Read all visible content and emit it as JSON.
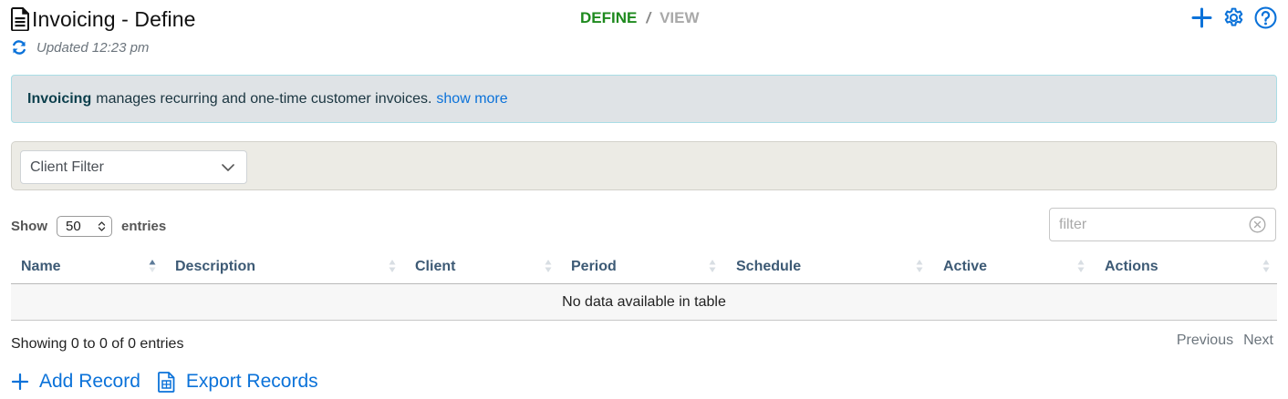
{
  "header": {
    "title": "Invoicing - Define",
    "updated": "Updated 12:23 pm"
  },
  "modes": {
    "define": "DEFINE",
    "separator": "/",
    "view": "VIEW"
  },
  "info": {
    "bold": "Invoicing",
    "text": "manages recurring and one-time customer invoices.",
    "link": "show more"
  },
  "filters": {
    "client_filter": "Client Filter"
  },
  "table_controls": {
    "show_label": "Show",
    "page_size": "50",
    "entries_label": "entries",
    "search_placeholder": "filter"
  },
  "table": {
    "columns": [
      "Name",
      "Description",
      "Client",
      "Period",
      "Schedule",
      "Active",
      "Actions"
    ],
    "empty_message": "No data available in table"
  },
  "footer": {
    "showing": "Showing 0 to 0 of 0 entries",
    "previous": "Previous",
    "next": "Next"
  },
  "actions": {
    "add": "Add Record",
    "export": "Export Records"
  },
  "colors": {
    "accent": "#0b72d9",
    "define_green": "#1e8a1e",
    "header_text": "#3d5a75"
  }
}
